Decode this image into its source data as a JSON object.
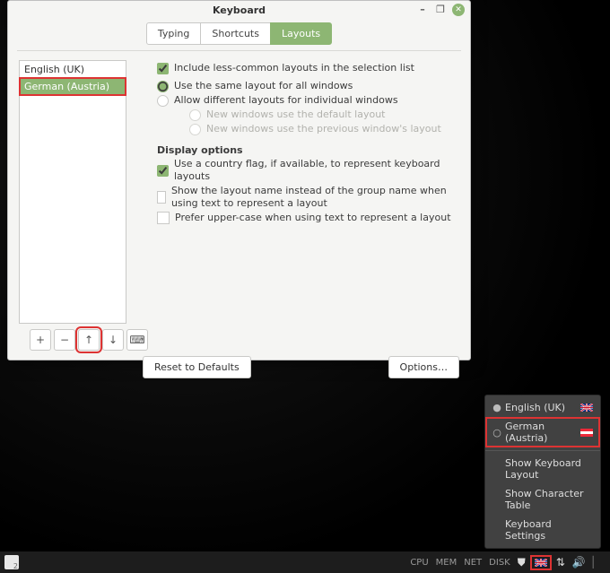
{
  "window": {
    "title": "Keyboard",
    "tabs": {
      "typing": "Typing",
      "shortcuts": "Shortcuts",
      "layouts": "Layouts"
    }
  },
  "layouts": {
    "list": [
      "English (UK)",
      "German (Austria)"
    ],
    "include_less_common": "Include less-common layouts in the selection list",
    "same_all": "Use the same layout for all windows",
    "diff_each": "Allow different layouts for individual windows",
    "new_default": "New windows use the default layout",
    "new_prev": "New windows use the previous window's layout",
    "display_hdr": "Display options",
    "flag": "Use a country flag, if available, to represent keyboard layouts",
    "show_name": "Show the layout name instead of the group name when using text to represent a layout",
    "upper": "Prefer upper-case when using text to represent a layout",
    "reset": "Reset to Defaults",
    "options": "Options…"
  },
  "menu": {
    "en": "English (UK)",
    "de": "German (Austria)",
    "show_layout": "Show Keyboard Layout",
    "char_table": "Show Character Table",
    "kbd_settings": "Keyboard Settings"
  },
  "panel": {
    "cpu": "CPU",
    "mem": "MEM",
    "net": "NET",
    "disk": "DISK"
  }
}
